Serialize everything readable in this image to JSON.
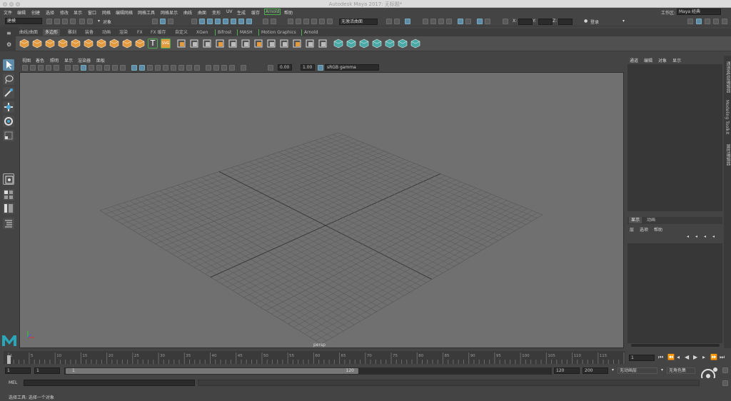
{
  "window": {
    "title": "Autodesk Maya 2017: 无标题*"
  },
  "menu": [
    "文件",
    "编辑",
    "创建",
    "选择",
    "修改",
    "显示",
    "窗口",
    "网格",
    "编辑网格",
    "网格工具",
    "网格显示",
    "曲线",
    "曲面",
    "变形",
    "UV",
    "生成",
    "缓存",
    "Arnold",
    "帮助"
  ],
  "status": {
    "mode": "建模",
    "object_label": "对象",
    "live_surface": "无激活曲面",
    "workspace_label": "工作区:",
    "workspace_value": "Maya 经典",
    "x_label": "X:",
    "y_label": "Y:",
    "z_label": "Z:",
    "login": "登录"
  },
  "shelf_tabs": [
    "曲线/曲面",
    "多边形",
    "雕刻",
    "装备",
    "动画",
    "渲染",
    "FX",
    "FX 缓存",
    "自定义",
    "XGen",
    "Bifrost",
    "MASH",
    "Motion Graphics",
    "Arnold"
  ],
  "shelf_active": 1,
  "shelf_icons": [
    "sphere-icon",
    "cube-icon",
    "cylinder-icon",
    "cone-icon",
    "torus-icon",
    "plane-icon",
    "disc-icon",
    "prism-icon",
    "pyramid-icon",
    "pipe-icon",
    "text-icon",
    "svg-icon",
    "combine-icon",
    "separate-icon",
    "smooth-icon",
    "boolean-icon",
    "mirror-icon",
    "extrude-icon",
    "bevel-icon",
    "bridge-icon",
    "append-icon",
    "fill-hole-icon",
    "multicut-icon",
    "target-weld-icon",
    "planar-uv-icon",
    "auto-uv-icon",
    "cylindrical-uv-icon",
    "spherical-uv-icon",
    "uv-editor-icon",
    "checker-icon",
    "symmetry-icon"
  ],
  "shelf_svg_label": "SVG",
  "shelf_text_label": "T",
  "viewport": {
    "menu": [
      "视图",
      "着色",
      "照明",
      "显示",
      "渲染器",
      "面板"
    ],
    "exposure": "0.00",
    "gamma": "1.00",
    "colorspace": "sRGB gamma",
    "camera": "persp"
  },
  "channel_box": {
    "menu": [
      "通道",
      "编辑",
      "对象",
      "显示"
    ]
  },
  "layer_editor": {
    "tabs": [
      "显示",
      "动画"
    ],
    "menu": [
      "层",
      "选项",
      "帮助"
    ]
  },
  "side_tabs": [
    "通道盒/层编辑器",
    "Modeling Toolkit",
    "属性编辑器"
  ],
  "timeline": {
    "ticks": [
      "1",
      "5",
      "10",
      "15",
      "20",
      "25",
      "30",
      "35",
      "40",
      "45",
      "50",
      "55",
      "60",
      "65",
      "70",
      "75",
      "80",
      "85",
      "90",
      "95",
      "100",
      "105",
      "110",
      "115",
      "120"
    ],
    "current_frame": "1"
  },
  "range": {
    "start": "1",
    "playback_start": "1",
    "slider_start": "1",
    "slider_end": "120",
    "playback_end": "120",
    "end": "200",
    "anim_layer": "无动画层",
    "char_set": "无角色集"
  },
  "command": {
    "lang": "MEL"
  },
  "help_line": "选择工具: 选择一个对象",
  "colors": {
    "accent": "#5d8ba8",
    "shelf_icon": "#e39a3e",
    "uv_icon": "#48a9a6",
    "maya_logo": "#2aa6b8"
  }
}
